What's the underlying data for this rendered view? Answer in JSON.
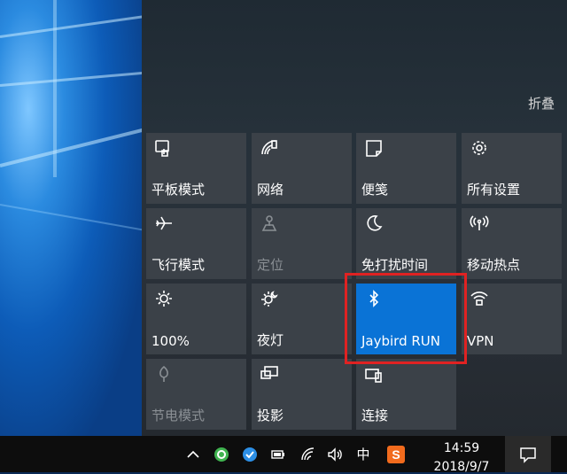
{
  "action_center": {
    "collapse_label": "折叠",
    "tiles": [
      {
        "label": "平板模式",
        "icon": "tablet-mode-icon",
        "state": "normal"
      },
      {
        "label": "网络",
        "icon": "network-icon",
        "state": "normal"
      },
      {
        "label": "便笺",
        "icon": "note-icon",
        "state": "normal"
      },
      {
        "label": "所有设置",
        "icon": "settings-gear-icon",
        "state": "normal"
      },
      {
        "label": "飞行模式",
        "icon": "airplane-icon",
        "state": "normal"
      },
      {
        "label": "定位",
        "icon": "location-icon",
        "state": "disabled"
      },
      {
        "label": "免打扰时间",
        "icon": "moon-icon",
        "state": "normal"
      },
      {
        "label": "移动热点",
        "icon": "hotspot-icon",
        "state": "normal"
      },
      {
        "label": "100%",
        "icon": "brightness-icon",
        "state": "normal"
      },
      {
        "label": "夜灯",
        "icon": "night-light-icon",
        "state": "normal"
      },
      {
        "label": "Jaybird RUN",
        "icon": "bluetooth-icon",
        "state": "active"
      },
      {
        "label": "VPN",
        "icon": "vpn-icon",
        "state": "normal"
      },
      {
        "label": "节电模式",
        "icon": "battery-saver-icon",
        "state": "disabled"
      },
      {
        "label": "投影",
        "icon": "project-icon",
        "state": "normal"
      },
      {
        "label": "连接",
        "icon": "connect-icon",
        "state": "normal"
      }
    ]
  },
  "taskbar": {
    "ime_label": "中",
    "sogou_label": "S",
    "time": "14:59",
    "date": "2018/9/7"
  },
  "colors": {
    "tile_bg": "#3b4148",
    "tile_active": "#0a73d6",
    "highlight": "#e02222",
    "taskbar": "#0d0d0d"
  }
}
